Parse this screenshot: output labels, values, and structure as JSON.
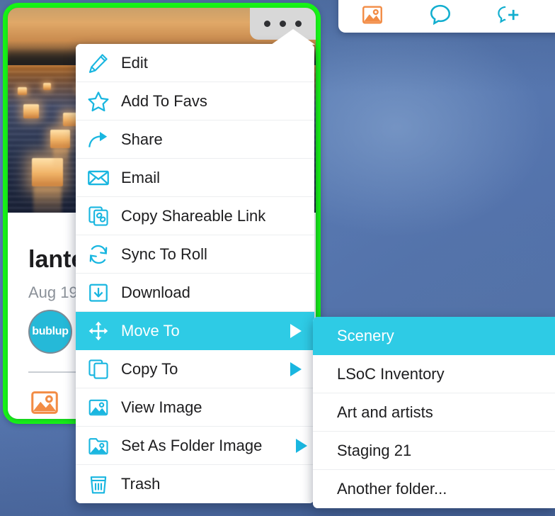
{
  "colors": {
    "accent_cyan": "#2ECBE5",
    "icon_blue": "#19B6E0",
    "selection_green": "#17F317",
    "orange": "#F28C45",
    "background_blue": "#5A7FB5",
    "avatar_teal": "#25B9D8"
  },
  "background": {
    "name": "blurred-blue-backdrop"
  },
  "second_card": {
    "name": "adjacent-item-card",
    "actions": [
      {
        "name": "image-type-icon",
        "icon": "image-icon"
      },
      {
        "name": "comment-icon",
        "icon": "chat-bubble-icon"
      },
      {
        "name": "add-comment-icon",
        "icon": "chat-bubble-plus-icon"
      }
    ]
  },
  "item_card": {
    "title": "lante",
    "date": "Aug 19,",
    "avatar_label": "bublup",
    "thumbnail_alt": "floating lanterns on water at sunset",
    "type_icon": "image-icon",
    "more_button_icon": "more-dots-icon"
  },
  "context_menu": {
    "items": [
      {
        "label": "Edit",
        "icon": "pencil-icon",
        "has_submenu": false,
        "active": false
      },
      {
        "label": "Add To Favs",
        "icon": "star-icon",
        "has_submenu": false,
        "active": false
      },
      {
        "label": "Share",
        "icon": "share-arrow-icon",
        "has_submenu": false,
        "active": false
      },
      {
        "label": "Email",
        "icon": "envelope-icon",
        "has_submenu": false,
        "active": false
      },
      {
        "label": "Copy Shareable Link",
        "icon": "copy-link-icon",
        "has_submenu": false,
        "active": false
      },
      {
        "label": "Sync To Roll",
        "icon": "sync-icon",
        "has_submenu": false,
        "active": false
      },
      {
        "label": "Download",
        "icon": "download-icon",
        "has_submenu": false,
        "active": false
      },
      {
        "label": "Move To",
        "icon": "move-arrows-icon",
        "has_submenu": true,
        "active": true
      },
      {
        "label": "Copy To",
        "icon": "copy-icon",
        "has_submenu": true,
        "active": false
      },
      {
        "label": "View Image",
        "icon": "image-icon",
        "has_submenu": false,
        "active": false
      },
      {
        "label": "Set As Folder Image",
        "icon": "folder-image-icon",
        "has_submenu": true,
        "active": false
      },
      {
        "label": "Trash",
        "icon": "trash-icon",
        "has_submenu": false,
        "active": false
      }
    ]
  },
  "submenu": {
    "title": "Move To",
    "items": [
      {
        "label": "Scenery",
        "active": true
      },
      {
        "label": "LSoC Inventory",
        "active": false
      },
      {
        "label": "Art and artists",
        "active": false
      },
      {
        "label": "Staging 21",
        "active": false
      },
      {
        "label": "Another folder...",
        "active": false
      }
    ]
  }
}
